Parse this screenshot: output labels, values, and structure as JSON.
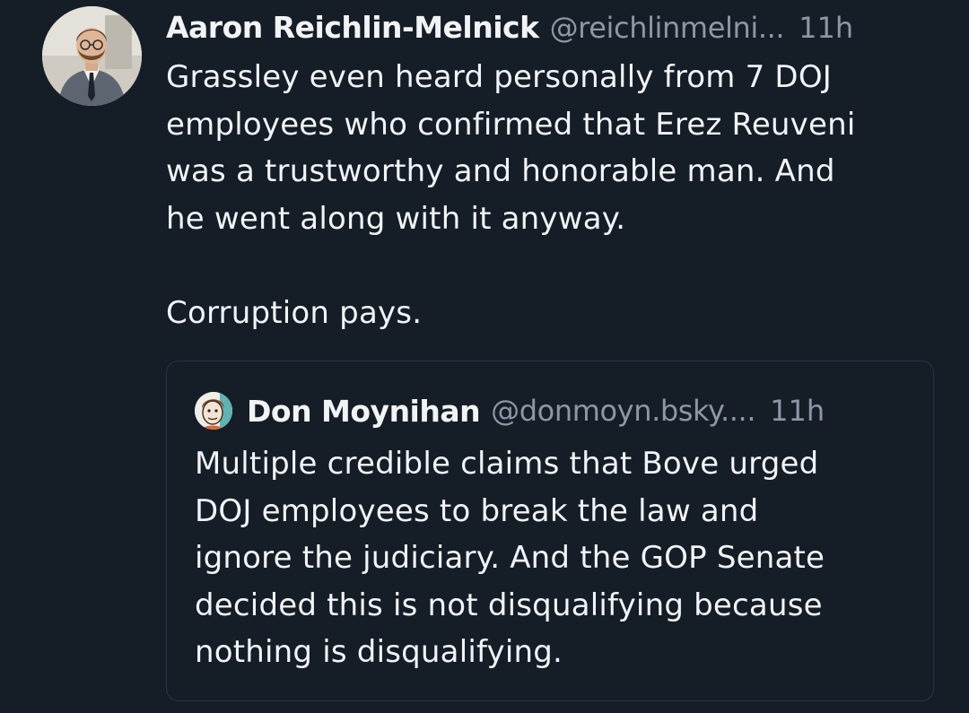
{
  "post": {
    "author": {
      "display_name": "Aaron Reichlin-Melnick",
      "handle": "@reichlinmelni...",
      "avatar_icon": "profile-photo-man-in-suit"
    },
    "timestamp": "11h",
    "text": "Grassley even heard personally from 7 DOJ\nemployees who confirmed that Erez Reuveni\nwas a trustworthy and honorable man. And\nhe went along with it anyway.\n\nCorruption pays."
  },
  "quoted_post": {
    "author": {
      "display_name": "Don Moynihan",
      "handle": "@donmoyn.bsky....",
      "avatar_icon": "cartoon-face-avatar"
    },
    "timestamp": "11h",
    "text": "Multiple credible claims that Bove urged\nDOJ employees to break the law and\nignore the judiciary. And the GOP Senate\ndecided this is not disqualifying because\nnothing is disqualifying."
  },
  "colors": {
    "background": "#151d27",
    "text_primary": "#f1f3f5",
    "text_secondary": "#8b98a5",
    "card_border": "#2a3644"
  }
}
